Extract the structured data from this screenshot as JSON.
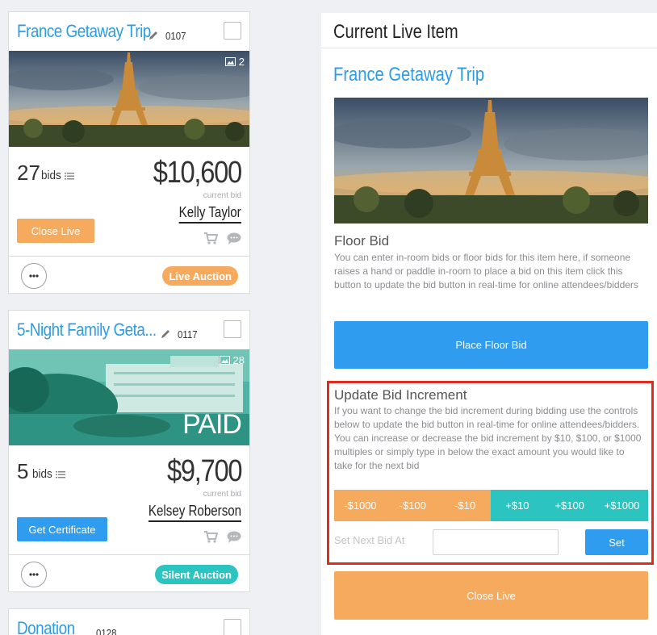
{
  "colors": {
    "link_blue": "#2b9de6",
    "button_blue": "#2f9cf0",
    "orange": "#f6aa5d",
    "teal": "#2cc4c0",
    "highlight_red": "#e02b20"
  },
  "cards": [
    {
      "title": "France Getaway Trip",
      "item_number": "0107",
      "image_count": "2",
      "paid_label": "",
      "bids_count": "27",
      "bids_label": "bids",
      "amount": "$10,600",
      "current_bid_label": "current bid",
      "bidder": "Kelly Taylor",
      "action_label": "Close Live",
      "badge": "Live Auction",
      "image_icon": "image-icon",
      "icons": [
        "pencil-icon",
        "list-icon",
        "cart-icon",
        "chat-icon",
        "more-icon"
      ]
    },
    {
      "title": "5-Night Family Geta...",
      "item_number": "0117",
      "image_count": "28",
      "paid_label": "PAID",
      "bids_count": "5",
      "bids_label": "bids",
      "amount": "$9,700",
      "current_bid_label": "current bid",
      "bidder": "Kelsey Roberson",
      "action_label": "Get Certificate",
      "badge": "Silent Auction",
      "image_icon": "image-icon",
      "icons": [
        "pencil-icon",
        "list-icon",
        "cart-icon",
        "chat-icon",
        "more-icon"
      ]
    },
    {
      "title": "Donation",
      "item_number": "0128"
    }
  ],
  "panel": {
    "header": "Current Live Item",
    "item_title": "France Getaway Trip",
    "floor_bid": {
      "title": "Floor Bid",
      "description": "You can enter in-room bids or floor bids for this item here, if someone raises a hand or paddle in-room to place a bid on this item click this button to update the bid button in real-time for online attendees/bidders",
      "button": "Place Floor Bid"
    },
    "increment": {
      "title": "Update Bid Increment",
      "description": "If you want to change the bid increment during bidding use the controls below to update the bid button in real-time for online attendees/bidders. You can increase or decrease the bid increment by $10, $100, or $1000 multiples or simply type in below the exact amount you would like to take for the next bid",
      "decrease": [
        "-$1000",
        "-$100",
        "-$10"
      ],
      "increase": [
        "+$10",
        "+$100",
        "+$1000"
      ],
      "next_bid_label": "Set Next Bid At",
      "next_bid_value": "",
      "set_button": "Set"
    },
    "close_button": "Close Live"
  }
}
